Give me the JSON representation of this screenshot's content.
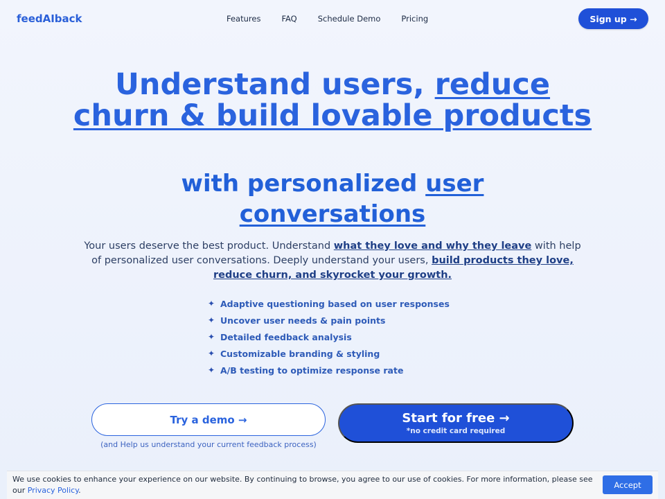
{
  "nav": {
    "logo": "feedAIback",
    "links": [
      "Features",
      "FAQ",
      "Schedule Demo",
      "Pricing"
    ],
    "signup_label": "Sign up →"
  },
  "hero": {
    "title_plain": "Understand users, ",
    "title_underlined": "reduce churn & build lovable products",
    "subtitle_plain": "with personalized ",
    "subtitle_underlined": "user conversations"
  },
  "lead": {
    "part1": "Your users deserve the best product. Understand ",
    "part2": "what they love and why they leave",
    "part3": " with help of personalized user conversations. Deeply understand your users, ",
    "part4": "build products they love, reduce churn, and skyrocket your growth."
  },
  "features": [
    "Adaptive questioning based on user responses",
    "Uncover user needs & pain points",
    "Detailed feedback analysis",
    "Customizable branding & styling",
    "A/B testing to optimize response rate"
  ],
  "feature_icon": "sparkle-icon",
  "cta": {
    "demo_label": "Try a demo →",
    "demo_note": "(and Help us understand your current feedback process)",
    "start_label": "Start for free →",
    "start_sub": "*no credit card required"
  },
  "cookie": {
    "text": "We use cookies to enhance your experience on our website. By continuing to browse, you agree to our use of cookies. For more information, please see our ",
    "link": "Privacy Policy",
    "end": ".",
    "accept_label": "Accept"
  },
  "colors": {
    "primary": "#1f50d8",
    "accent": "#2a63de",
    "background": "#eef3fc"
  }
}
